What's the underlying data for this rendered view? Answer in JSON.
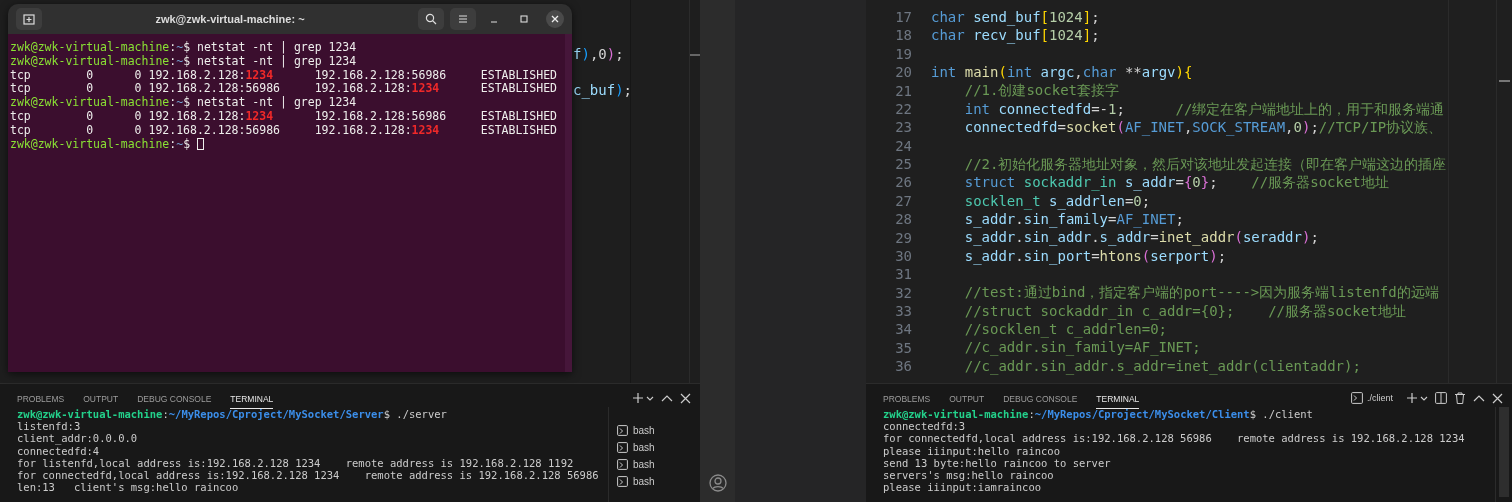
{
  "left_editor": {
    "code_fragments": [
      [
        {
          "kind": "variable",
          "text": "f"
        },
        {
          "kind": "bracket3",
          "text": ")"
        },
        {
          "kind": "plain",
          "text": ",0"
        },
        {
          "kind": "bracket2",
          "text": ")"
        },
        {
          "kind": "plain",
          "text": ";"
        }
      ],
      [
        {
          "kind": "variable",
          "text": "c_buf"
        },
        {
          "kind": "bracket3",
          "text": ")"
        },
        {
          "kind": "plain",
          "text": ";"
        }
      ]
    ]
  },
  "terminal_window": {
    "title": "zwk@zwk-virtual-machine: ~",
    "cursor_visible": true,
    "lines": [
      [
        {
          "kind": "user",
          "text": "zwk@zwk-virtual-machine"
        },
        {
          "kind": "plain",
          "text": ":"
        },
        {
          "kind": "path",
          "text": "~"
        },
        {
          "kind": "plain",
          "text": "$ netstat -nt | grep 1234"
        }
      ],
      [
        {
          "kind": "user",
          "text": "zwk@zwk-virtual-machine"
        },
        {
          "kind": "plain",
          "text": ":"
        },
        {
          "kind": "path",
          "text": "~"
        },
        {
          "kind": "plain",
          "text": "$ netstat -nt | grep 1234"
        }
      ],
      [
        {
          "kind": "plain",
          "text": "tcp        0      0 192.168.2.128:"
        },
        {
          "kind": "match",
          "text": "1234"
        },
        {
          "kind": "plain",
          "text": "      192.168.2.128:56986     ESTABLISHED"
        }
      ],
      [
        {
          "kind": "plain",
          "text": "tcp        0      0 192.168.2.128:56986     192.168.2.128:"
        },
        {
          "kind": "match",
          "text": "1234"
        },
        {
          "kind": "plain",
          "text": "      ESTABLISHED"
        }
      ],
      [
        {
          "kind": "user",
          "text": "zwk@zwk-virtual-machine"
        },
        {
          "kind": "plain",
          "text": ":"
        },
        {
          "kind": "path",
          "text": "~"
        },
        {
          "kind": "plain",
          "text": "$ netstat -nt | grep 1234"
        }
      ],
      [
        {
          "kind": "plain",
          "text": "tcp        0      0 192.168.2.128:"
        },
        {
          "kind": "match",
          "text": "1234"
        },
        {
          "kind": "plain",
          "text": "      192.168.2.128:56986     ESTABLISHED"
        }
      ],
      [
        {
          "kind": "plain",
          "text": "tcp        0      0 192.168.2.128:56986     192.168.2.128:"
        },
        {
          "kind": "match",
          "text": "1234"
        },
        {
          "kind": "plain",
          "text": "      ESTABLISHED"
        }
      ],
      [
        {
          "kind": "user",
          "text": "zwk@zwk-virtual-machine"
        },
        {
          "kind": "plain",
          "text": ":"
        },
        {
          "kind": "path",
          "text": "~"
        },
        {
          "kind": "plain",
          "text": "$"
        }
      ]
    ]
  },
  "left_panel": {
    "tabs": [
      {
        "label": "PROBLEMS",
        "selected": false
      },
      {
        "label": "OUTPUT",
        "selected": false
      },
      {
        "label": "DEBUG CONSOLE",
        "selected": false
      },
      {
        "label": "TERMINAL",
        "selected": true
      }
    ],
    "terminal_lines": [
      [
        {
          "kind": "user",
          "text": "zwk@zwk-virtual-machine"
        },
        {
          "kind": "plain",
          "text": ":"
        },
        {
          "kind": "path",
          "text": "~/MyRepos/Cproject/MySocket/Server"
        },
        {
          "kind": "plain",
          "text": "$ ./server"
        }
      ],
      [
        {
          "kind": "plain",
          "text": "listenfd:3"
        }
      ],
      [
        {
          "kind": "plain",
          "text": "client_addr:0.0.0.0"
        }
      ],
      [
        {
          "kind": "plain",
          "text": "connectedfd:4"
        }
      ],
      [
        {
          "kind": "plain",
          "text": "for listenfd,local address is:192.168.2.128 1234    remote address is 192.168.2.128 1192"
        }
      ],
      [
        {
          "kind": "plain",
          "text": "for connectedfd,local address is:192.168.2.128 1234    remote address is 192.168.2.128 56986"
        }
      ],
      [
        {
          "kind": "plain",
          "text": "len:13   client's msg:hello raincoo"
        }
      ]
    ],
    "terminal_list": [
      {
        "label": "bash"
      },
      {
        "label": "bash"
      },
      {
        "label": "bash"
      },
      {
        "label": "bash"
      }
    ]
  },
  "right_editor": {
    "lines": [
      {
        "number": "17",
        "code": [
          {
            "kind": "keyword",
            "text": "char"
          },
          {
            "kind": "variable",
            "text": " send_buf"
          },
          {
            "kind": "bracket1",
            "text": "["
          },
          {
            "kind": "number",
            "text": "1024"
          },
          {
            "kind": "bracket1",
            "text": "]"
          },
          {
            "kind": "plain",
            "text": ";"
          }
        ]
      },
      {
        "number": "18",
        "code": [
          {
            "kind": "keyword",
            "text": "char"
          },
          {
            "kind": "variable",
            "text": " recv_buf"
          },
          {
            "kind": "bracket1",
            "text": "["
          },
          {
            "kind": "number",
            "text": "1024"
          },
          {
            "kind": "bracket1",
            "text": "]"
          },
          {
            "kind": "plain",
            "text": ";"
          }
        ]
      },
      {
        "number": "19"
      },
      {
        "number": "20",
        "code": [
          {
            "kind": "keyword",
            "text": "int"
          },
          {
            "kind": "function",
            "text": " main"
          },
          {
            "kind": "bracket1",
            "text": "("
          },
          {
            "kind": "keyword",
            "text": "int"
          },
          {
            "kind": "variable",
            "text": " argc"
          },
          {
            "kind": "plain",
            "text": ","
          },
          {
            "kind": "keyword",
            "text": "char"
          },
          {
            "kind": "plain",
            "text": " **"
          },
          {
            "kind": "variable",
            "text": "argv"
          },
          {
            "kind": "bracket1",
            "text": "){"
          }
        ]
      },
      {
        "number": "21",
        "code": [
          {
            "kind": "comment",
            "text": "    //1.创建socket套接字"
          }
        ]
      },
      {
        "number": "22",
        "code": [
          {
            "kind": "keyword",
            "text": "    int"
          },
          {
            "kind": "variable",
            "text": " connectedfd"
          },
          {
            "kind": "plain",
            "text": "=-"
          },
          {
            "kind": "number",
            "text": "1"
          },
          {
            "kind": "plain",
            "text": ";"
          },
          {
            "kind": "comment",
            "text": "      //绑定在客户端地址上的，用于和服务端通"
          }
        ]
      },
      {
        "number": "23",
        "code": [
          {
            "kind": "variable",
            "text": "    connectedfd"
          },
          {
            "kind": "plain",
            "text": "="
          },
          {
            "kind": "function",
            "text": "socket"
          },
          {
            "kind": "bracket2",
            "text": "("
          },
          {
            "kind": "macro",
            "text": "AF_INET"
          },
          {
            "kind": "plain",
            "text": ","
          },
          {
            "kind": "macro",
            "text": "SOCK_STREAM"
          },
          {
            "kind": "plain",
            "text": ","
          },
          {
            "kind": "number",
            "text": "0"
          },
          {
            "kind": "bracket2",
            "text": ")"
          },
          {
            "kind": "plain",
            "text": ";"
          },
          {
            "kind": "comment",
            "text": "//TCP/IP协议族、"
          }
        ]
      },
      {
        "number": "24"
      },
      {
        "number": "25",
        "code": [
          {
            "kind": "comment",
            "text": "    //2.初始化服务器地址对象，然后对该地址发起连接（即在客户端这边的插座"
          }
        ]
      },
      {
        "number": "26",
        "code": [
          {
            "kind": "keyword",
            "text": "    struct"
          },
          {
            "kind": "type",
            "text": " sockaddr_in"
          },
          {
            "kind": "variable",
            "text": " s_addr"
          },
          {
            "kind": "plain",
            "text": "="
          },
          {
            "kind": "bracket2",
            "text": "{"
          },
          {
            "kind": "number",
            "text": "0"
          },
          {
            "kind": "bracket2",
            "text": "}"
          },
          {
            "kind": "plain",
            "text": ";"
          },
          {
            "kind": "comment",
            "text": "    //服务器socket地址"
          }
        ]
      },
      {
        "number": "27",
        "code": [
          {
            "kind": "type",
            "text": "    socklen_t"
          },
          {
            "kind": "variable",
            "text": " s_addrlen"
          },
          {
            "kind": "plain",
            "text": "="
          },
          {
            "kind": "number",
            "text": "0"
          },
          {
            "kind": "plain",
            "text": ";"
          }
        ]
      },
      {
        "number": "28",
        "code": [
          {
            "kind": "variable",
            "text": "    s_addr"
          },
          {
            "kind": "plain",
            "text": "."
          },
          {
            "kind": "variable",
            "text": "sin_family"
          },
          {
            "kind": "plain",
            "text": "="
          },
          {
            "kind": "macro",
            "text": "AF_INET"
          },
          {
            "kind": "plain",
            "text": ";"
          }
        ]
      },
      {
        "number": "29",
        "code": [
          {
            "kind": "variable",
            "text": "    s_addr"
          },
          {
            "kind": "plain",
            "text": "."
          },
          {
            "kind": "variable",
            "text": "sin_addr"
          },
          {
            "kind": "plain",
            "text": "."
          },
          {
            "kind": "variable",
            "text": "s_addr"
          },
          {
            "kind": "plain",
            "text": "="
          },
          {
            "kind": "function",
            "text": "inet_addr"
          },
          {
            "kind": "bracket2",
            "text": "("
          },
          {
            "kind": "variable",
            "text": "seraddr"
          },
          {
            "kind": "bracket2",
            "text": ")"
          },
          {
            "kind": "plain",
            "text": ";"
          }
        ]
      },
      {
        "number": "30",
        "code": [
          {
            "kind": "variable",
            "text": "    s_addr"
          },
          {
            "kind": "plain",
            "text": "."
          },
          {
            "kind": "variable",
            "text": "sin_port"
          },
          {
            "kind": "plain",
            "text": "="
          },
          {
            "kind": "function",
            "text": "htons"
          },
          {
            "kind": "bracket2",
            "text": "("
          },
          {
            "kind": "variable",
            "text": "serport"
          },
          {
            "kind": "bracket2",
            "text": ")"
          },
          {
            "kind": "plain",
            "text": ";"
          }
        ]
      },
      {
        "number": "31"
      },
      {
        "number": "32",
        "code": [
          {
            "kind": "comment",
            "text": "    //test:通过bind，指定客户端的port---->因为服务端listenfd的远端"
          }
        ]
      },
      {
        "number": "33",
        "code": [
          {
            "kind": "comment",
            "text": "    //struct sockaddr_in c_addr={0};    //服务器socket地址"
          }
        ]
      },
      {
        "number": "34",
        "code": [
          {
            "kind": "comment",
            "text": "    //socklen_t c_addrlen=0;"
          }
        ]
      },
      {
        "number": "35",
        "code": [
          {
            "kind": "comment",
            "text": "    //c_addr.sin_family=AF_INET;"
          }
        ]
      },
      {
        "number": "36",
        "code": [
          {
            "kind": "comment",
            "text": "    //c_addr.sin_addr.s_addr=inet_addr(clientaddr);"
          }
        ]
      }
    ]
  },
  "right_panel": {
    "tabs": [
      {
        "label": "PROBLEMS",
        "selected": false
      },
      {
        "label": "OUTPUT",
        "selected": false
      },
      {
        "label": "DEBUG CONSOLE",
        "selected": false
      },
      {
        "label": "TERMINAL",
        "selected": true
      }
    ],
    "terminal_name": "./client",
    "terminal_lines": [
      [
        {
          "kind": "user",
          "text": "zwk@zwk-virtual-machine"
        },
        {
          "kind": "plain",
          "text": ":"
        },
        {
          "kind": "path",
          "text": "~/MyRepos/Cproject/MySocket/Client"
        },
        {
          "kind": "plain",
          "text": "$ ./client"
        }
      ],
      [
        {
          "kind": "plain",
          "text": "connectedfd:3"
        }
      ],
      [
        {
          "kind": "plain",
          "text": "for connectedfd,local address is:192.168.2.128 56986    remote address is 192.168.2.128 1234"
        }
      ],
      [
        {
          "kind": "plain",
          "text": "please iiinput:hello raincoo"
        }
      ],
      [
        {
          "kind": "plain",
          "text": "send 13 byte:hello raincoo to server"
        }
      ],
      [
        {
          "kind": "plain",
          "text": "servers's msg:hello raincoo"
        }
      ],
      [
        {
          "kind": "plain",
          "text": "please iiinput:iamraincoo"
        }
      ]
    ]
  }
}
